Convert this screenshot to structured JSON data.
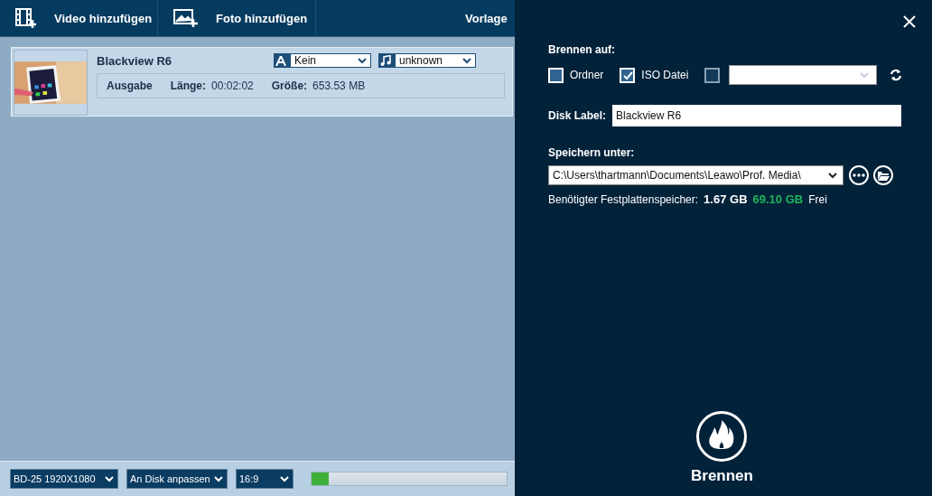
{
  "toolbar": {
    "buttons": [
      {
        "kind": "video",
        "label": "Video hinzufügen"
      },
      {
        "label": "Foto hinzufügen"
      }
    ],
    "cut_label": "Vorlage"
  },
  "video_item": {
    "title": "Blackview R6",
    "subtitle_select": {
      "value": "Kein"
    },
    "audio_select": {
      "value": "unknown"
    },
    "output_label": "Ausgabe",
    "length_label": "Länge:",
    "length": "00:02:02",
    "size_label": "Größe:",
    "size": "653.53 MB"
  },
  "bottom_bar": {
    "selects": [
      "BD-25 1920X1080",
      "An Disk anpassen",
      "16:9"
    ],
    "progress": {
      "level": 0.09
    }
  },
  "burn_panel": {
    "target_label": "Brennen auf:",
    "targets": [
      {
        "label": "Ordner",
        "checked": false
      },
      {
        "label": "ISO Datei",
        "checked": true
      }
    ],
    "drive": {
      "checked": false
    },
    "disk_label": {
      "label": "Disk Label:",
      "value": "Blackview R6"
    },
    "save": {
      "label": "Speichern unter:",
      "path": "C:\\Users\\thartmann\\Documents\\Leawo\\Prof. Media\\"
    },
    "space": {
      "label": "Benötigter Festplattenspeicher:",
      "required": "1.67 GB",
      "free": "69.10 GB",
      "free_label": "Frei"
    },
    "burn_button": "Brennen"
  }
}
